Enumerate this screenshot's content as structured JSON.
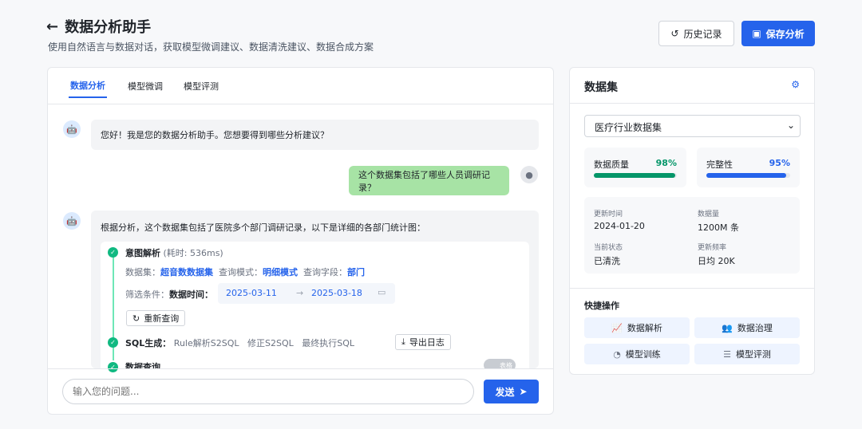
{
  "header": {
    "title": "数据分析助手",
    "subtitle": "使用自然语言与数据对话，获取模型微调建议、数据清洗建议、数据合成方案",
    "history": "历史记录",
    "save": "保存分析"
  },
  "tabs": [
    "数据分析",
    "模型微调",
    "模型评测"
  ],
  "chat": {
    "greeting": "您好！我是您的数据分析助手。您想要得到哪些分析建议？",
    "user_msg": "这个数据集包括了哪些人员调研记录？",
    "answer_intro": "根据分析，这个数据集包括了医院多个部门调研记录，以下是详细的各部门统计图：",
    "intent": {
      "title": "意图解析",
      "time": "(耗时: 536ms)",
      "dataset_label": "数据集：",
      "dataset": "超音数数据集",
      "mode_label": "查询模式：",
      "mode": "明细模式",
      "field_label": "查询字段：",
      "field": "部门",
      "filter_label": "筛选条件：",
      "filter_name": "数据时间：",
      "date_start": "2025-03-11",
      "date_end": "2025-03-18",
      "requery": "重新查询"
    },
    "sql": {
      "title": "SQL生成：",
      "s1": "Rule解析S2SQL",
      "s2": "修正S2SQL",
      "s3": "最终执行SQL",
      "export": "导出日志"
    },
    "query": {
      "title": "数据查询",
      "toggle": "表格"
    },
    "input_placeholder": "输入您的问题...",
    "send": "发送"
  },
  "dataset": {
    "title": "数据集",
    "selected": "医疗行业数据集",
    "quality": {
      "label": "数据质量",
      "value": "98%",
      "pct": 98
    },
    "complete": {
      "label": "完整性",
      "value": "95%",
      "pct": 95
    },
    "info": [
      {
        "label": "更新时间",
        "value": "2024-01-20"
      },
      {
        "label": "数据量",
        "value": "1200M 条"
      },
      {
        "label": "当前状态",
        "value": "已清洗"
      },
      {
        "label": "更新频率",
        "value": "日均 20K"
      }
    ],
    "quick_title": "快捷操作",
    "quick": [
      "数据解析",
      "数据治理",
      "模型训练",
      "模型评测"
    ]
  },
  "colors": {
    "accent": "#2563eb",
    "success": "#10b981"
  }
}
